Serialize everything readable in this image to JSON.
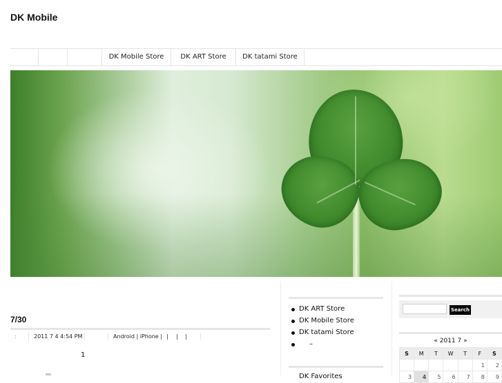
{
  "site": {
    "title": "DK Mobile"
  },
  "nav": {
    "items": [
      "",
      "",
      "",
      "DK Mobile Store",
      "DK ART Store",
      "DK tatami Store"
    ]
  },
  "post": {
    "title": "7/30",
    "meta": {
      "pre": ":",
      "date": "2011 7 4  4:54 PM",
      "categories": "Android | iPhone |",
      "sep1": "|",
      "sep2": "|",
      "sep3": "|"
    },
    "body": "1"
  },
  "links_widget": {
    "items": [
      "DK ART Store",
      "DK Mobile Store",
      "DK tatami Store",
      "–"
    ]
  },
  "widget2": {
    "title": "DK Favorites"
  },
  "search": {
    "placeholder": "",
    "button_label": "Search"
  },
  "calendar": {
    "caption": "« 2011   7  »",
    "days": [
      "S",
      "M",
      "T",
      "W",
      "T",
      "F",
      "S"
    ],
    "week1": [
      "",
      "",
      "",
      "",
      "",
      "1",
      "2"
    ],
    "week2": [
      "3",
      "4",
      "5",
      "6",
      "7",
      "8",
      "9"
    ]
  },
  "colors": {
    "accent": "#000000",
    "rule": "#e6e6e6",
    "hero_green": "#3f8a2c"
  }
}
